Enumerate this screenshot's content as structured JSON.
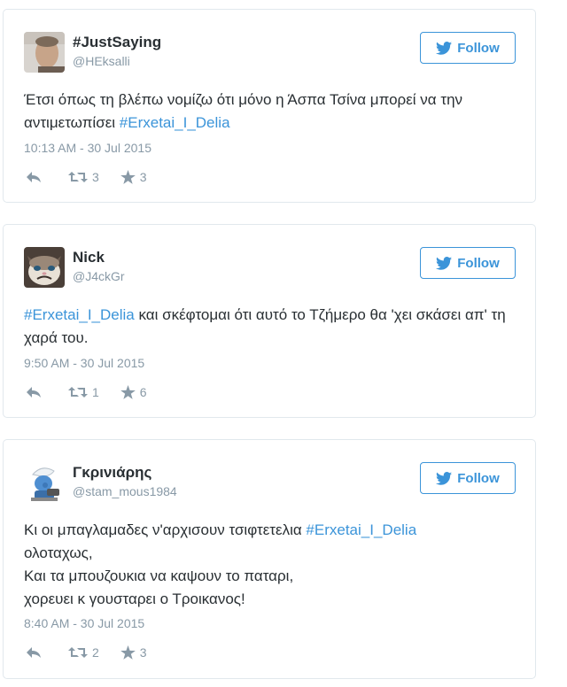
{
  "tweets": [
    {
      "name": "#JustSaying",
      "handle": "@HEksalli",
      "follow_label": "Follow",
      "text_parts": [
        {
          "text": "Έτσι όπως τη βλέπω νομίζω ότι μόνο η Άσπα Τσίνα μπορεί να την αντιμετωπίσει ",
          "type": "plain"
        },
        {
          "text": "#Erxetai_I_Delia",
          "type": "hashtag"
        }
      ],
      "time": "10:13 AM - 30 Jul 2015",
      "retweets": "3",
      "favorites": "3",
      "avatar_icon": "profile-photo-man"
    },
    {
      "name": "Nick",
      "handle": "@J4ckGr",
      "follow_label": "Follow",
      "text_parts": [
        {
          "text": "#Erxetai_I_Delia",
          "type": "hashtag"
        },
        {
          "text": " και σκέφτομαι ότι αυτό το Τζήμερο θα 'χει σκάσει απ' τη χαρά του.",
          "type": "plain"
        }
      ],
      "time": "9:50 AM - 30 Jul 2015",
      "retweets": "1",
      "favorites": "6",
      "avatar_icon": "grumpy-cat-avatar"
    },
    {
      "name": "Γκρινιάρης",
      "handle": "@stam_mous1984",
      "follow_label": "Follow",
      "text_lines": [
        [
          {
            "text": "Κι οι μπαγλαμαδες ν'αρχισουν τσιφτετελια ",
            "type": "plain"
          },
          {
            "text": "#Erxetai_I_Delia",
            "type": "hashtag"
          }
        ],
        [
          {
            "text": "ολοταχως,",
            "type": "plain"
          }
        ],
        [
          {
            "text": "Και τα μπουζουκια να καψουν το παταρι,",
            "type": "plain"
          }
        ],
        [
          {
            "text": "χορευει κ γουσταρει ο Τροικανος!",
            "type": "plain"
          }
        ]
      ],
      "time": "8:40 AM - 30 Jul 2015",
      "retweets": "2",
      "favorites": "3",
      "avatar_icon": "cartoon-smurf-avatar"
    }
  ],
  "colors": {
    "link": "#3b94d9",
    "meta": "#8899a6",
    "text": "#292f33",
    "border": "#e1e8ed"
  }
}
